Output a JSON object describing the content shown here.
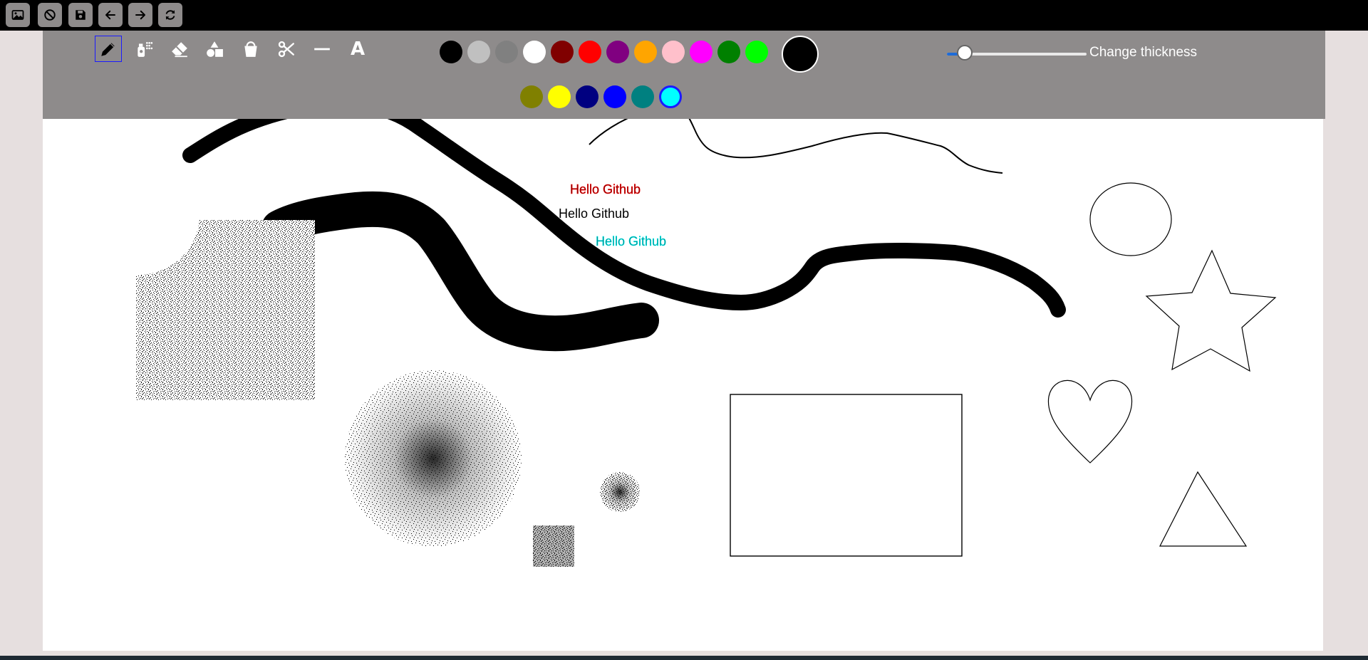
{
  "top_toolbar": {
    "buttons": [
      {
        "name": "open-image",
        "icon": "image-icon"
      },
      {
        "name": "clear",
        "icon": "ban-icon"
      },
      {
        "name": "save",
        "icon": "floppy-disk-icon"
      },
      {
        "name": "undo",
        "icon": "arrow-left-icon"
      },
      {
        "name": "redo",
        "icon": "arrow-right-icon"
      },
      {
        "name": "refresh",
        "icon": "refresh-icon"
      }
    ]
  },
  "tools": [
    {
      "name": "pencil",
      "icon": "pencil-icon",
      "active": true
    },
    {
      "name": "spray",
      "icon": "spray-can-icon",
      "active": false
    },
    {
      "name": "eraser",
      "icon": "eraser-icon",
      "active": false
    },
    {
      "name": "shapes",
      "icon": "shapes-icon",
      "active": false
    },
    {
      "name": "fill-bucket",
      "icon": "bucket-icon",
      "active": false
    },
    {
      "name": "cut",
      "icon": "scissors-icon",
      "active": false
    },
    {
      "name": "line",
      "icon": "line-icon",
      "active": false
    },
    {
      "name": "text",
      "icon": "text-a-icon",
      "label": "A",
      "active": false
    }
  ],
  "palette": {
    "row1": [
      "#000000",
      "#c0c0c0",
      "#808080",
      "#ffffff",
      "#800000",
      "#ff0000",
      "#800080",
      "#ffa500",
      "#ffc0cb",
      "#ff00ff",
      "#008000",
      "#00ff00"
    ],
    "row2": [
      "#808000",
      "#ffff00",
      "#000080",
      "#0000ff",
      "#008080",
      "#00ffff"
    ],
    "selected": "#00ffff",
    "current_color": "#000000"
  },
  "thickness": {
    "label": "Change thickness",
    "value_fraction": 0.08
  },
  "canvas": {
    "texts": [
      {
        "text": "Hello Github",
        "color": "#8b0000"
      },
      {
        "text": "Hello Github",
        "color": "#000000"
      },
      {
        "text": "Hello Github",
        "color": "#008b8b"
      }
    ]
  }
}
